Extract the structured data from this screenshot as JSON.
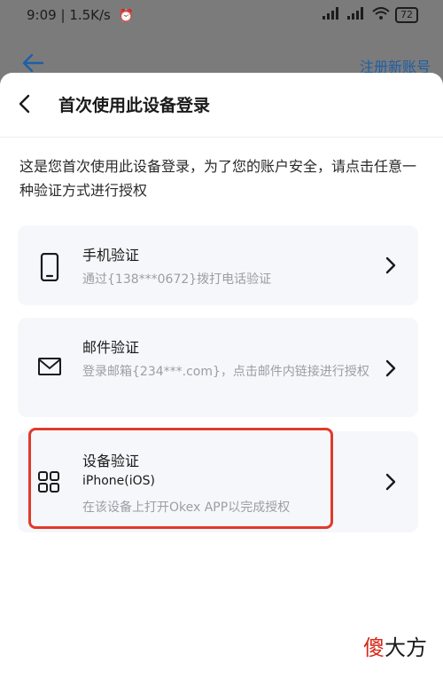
{
  "status_bar": {
    "time": "9:09",
    "speed": "1.5K/s",
    "signal": "HD",
    "battery": "72"
  },
  "background": {
    "register_link": "注册新账号"
  },
  "sheet": {
    "title": "首次使用此设备登录",
    "description": "这是您首次使用此设备登录，为了您的账户安全，请点击任意一种验证方式进行授权",
    "options": [
      {
        "title": "手机验证",
        "subtitle": "通过{138***0672}拨打电话验证",
        "icon": "phone-icon"
      },
      {
        "title": "邮件验证",
        "subtitle": "登录邮箱{234***.com}，点击邮件内链接进行授权",
        "icon": "mail-icon"
      },
      {
        "title": "设备验证",
        "device": "iPhone(iOS)",
        "subtitle": "在该设备上打开Okex APP以完成授权",
        "icon": "grid-icon"
      }
    ]
  },
  "watermark": {
    "first": "傻",
    "rest": "大方"
  },
  "colors": {
    "highlight": "#e03a2b",
    "link": "#1d5fa8",
    "card_bg": "#f6f7fa"
  }
}
